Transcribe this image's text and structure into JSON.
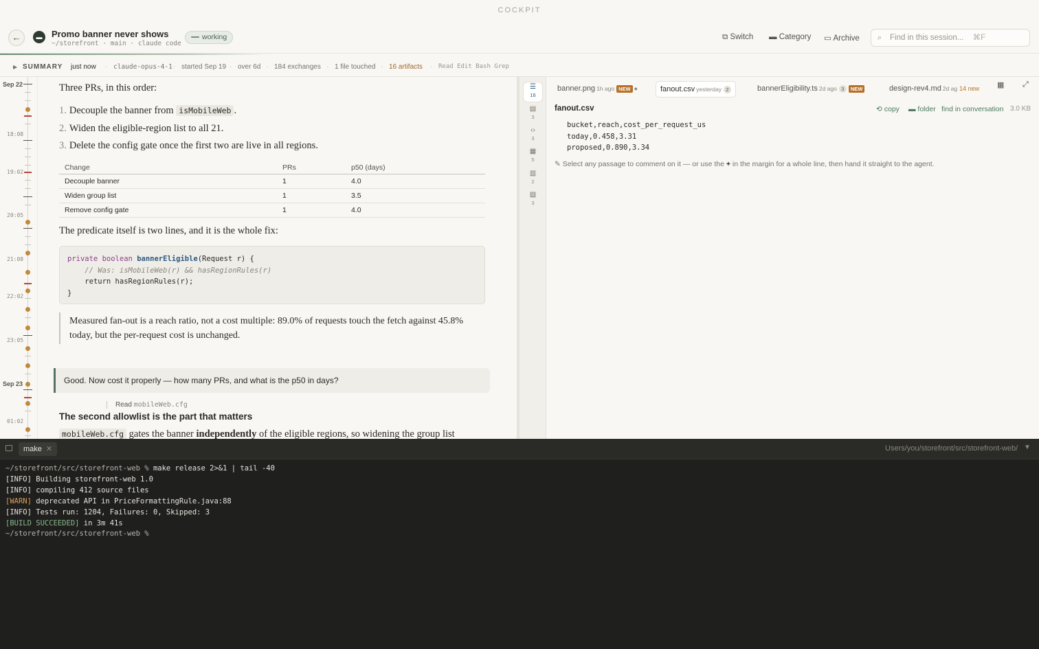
{
  "app": {
    "label": "COCKPIT"
  },
  "header": {
    "title": "Promo banner never shows",
    "subtitle": "~/storefront · main · claude code",
    "status": "working",
    "actions": {
      "switch": "Switch",
      "category": "Category",
      "archive": "Archive"
    },
    "search_placeholder": "Find in this session...",
    "search_shortcut": "⌘F"
  },
  "summary": {
    "label": "SUMMARY",
    "updated": "just now",
    "model": "claude-opus-4-1",
    "started": "started Sep 19",
    "duration": "over 6d",
    "exchanges": "184 exchanges",
    "files": "1 file touched",
    "artifacts": "16 artifacts",
    "tools": "Read Edit Bash Grep"
  },
  "timeline": {
    "dates": [
      "Sep 22",
      "Sep 23"
    ],
    "times": [
      "18:08",
      "19:02",
      "20:05",
      "21:08",
      "22:02",
      "23:05",
      "01:02"
    ]
  },
  "conversation": {
    "intro": "Three PRs, in this order:",
    "steps": [
      {
        "n": "1.",
        "before": "Decouple the banner from ",
        "code": "isMobileWeb",
        "after": "."
      },
      {
        "n": "2.",
        "before": "Widen the eligible-region list to all 21.",
        "code": "",
        "after": ""
      },
      {
        "n": "3.",
        "before": "Delete the config gate once the first two are live in all regions.",
        "code": "",
        "after": ""
      }
    ],
    "table": {
      "headers": [
        "Change",
        "PRs",
        "p50 (days)"
      ],
      "rows": [
        [
          "Decouple banner",
          "1",
          "4.0"
        ],
        [
          "Widen group list",
          "1",
          "3.5"
        ],
        [
          "Remove config gate",
          "1",
          "4.0"
        ]
      ]
    },
    "predicate_intro": "The predicate itself is two lines, and it is the whole fix:",
    "code": {
      "l1_kw1": "private",
      "l1_kw2": "boolean",
      "l1_fn": "bannerEligible",
      "l1_rest": "(Request r) {",
      "l2": "// Was: isMobileWeb(r) && hasRegionRules(r)",
      "l3_kw": "return",
      "l3_rest": " hasRegionRules(r);",
      "l4": "}"
    },
    "quote": "Measured fan-out is a reach ratio, not a cost multiple: 89.0% of requests touch the fetch against 45.8% today, but the per-request cost is unchanged.",
    "user_message": "Good. Now cost it properly — how many PRs, and what is the p50 in days?",
    "tool_call": {
      "verb": "Read",
      "target": "mobileWeb.cfg"
    },
    "heading": "The second allowlist is the part that matters",
    "para_code": "mobileWeb.cfg",
    "para_a": " gates the banner ",
    "para_bold": "independently",
    "para_b": " of the eligible regions, so widening the group list"
  },
  "artifact_rail": [
    {
      "icon": "list-icon",
      "count": "16"
    },
    {
      "icon": "document-icon",
      "count": "3"
    },
    {
      "icon": "code-icon",
      "count": "3"
    },
    {
      "icon": "table-icon",
      "count": "5"
    },
    {
      "icon": "clipboard-icon",
      "count": "2"
    },
    {
      "icon": "image-icon",
      "count": "3"
    }
  ],
  "artifacts": {
    "tabs": [
      {
        "name": "banner.png",
        "age": "1h ago",
        "badge": "NEW"
      },
      {
        "name": "fanout.csv",
        "age": "yesterday",
        "count": "2"
      },
      {
        "name": "bannerEligibility.ts",
        "age": "2d ago",
        "count": "3",
        "badge": "NEW"
      },
      {
        "name": "design-rev4.md",
        "age": "2d ag",
        "new_text": "14 new"
      }
    ],
    "file": {
      "name": "fanout.csv",
      "copy": "copy",
      "folder": "folder",
      "find": "find in conversation",
      "size": "3.0 KB",
      "lines": [
        "bucket,reach,cost_per_request_us",
        "today,0.458,3.31",
        "proposed,0.890,3.34"
      ]
    },
    "hint_a": "Select any passage to comment on it — or use the ",
    "hint_plus": "+",
    "hint_b": " in the margin for a whole line, then hand it straight to the agent."
  },
  "terminal": {
    "tab": "make",
    "path": "Users/you/storefront/src/storefront-web/",
    "prompt": "~/storefront/src/storefront-web %",
    "command": " make release 2>&1 | tail -40",
    "lines": [
      {
        "tag": "[INFO]",
        "text": " Building storefront-web 1.0"
      },
      {
        "tag": "[INFO]",
        "text": " compiling 412 source files"
      },
      {
        "tag": "[WARN]",
        "text": " deprecated API in PriceFormattingRule.java:88"
      },
      {
        "tag": "[INFO]",
        "text": " Tests run: 1204, Failures: 0, Skipped: 3"
      },
      {
        "tag": "[BUILD SUCCEEDED]",
        "text": " in 3m 41s"
      }
    ],
    "final_prompt": "~/storefront/src/storefront-web %"
  },
  "colors": {
    "accent": "#4e7a5e",
    "badge": "#b7702a",
    "alert": "#b8433a",
    "terminal_bg": "#1f1f1d"
  }
}
